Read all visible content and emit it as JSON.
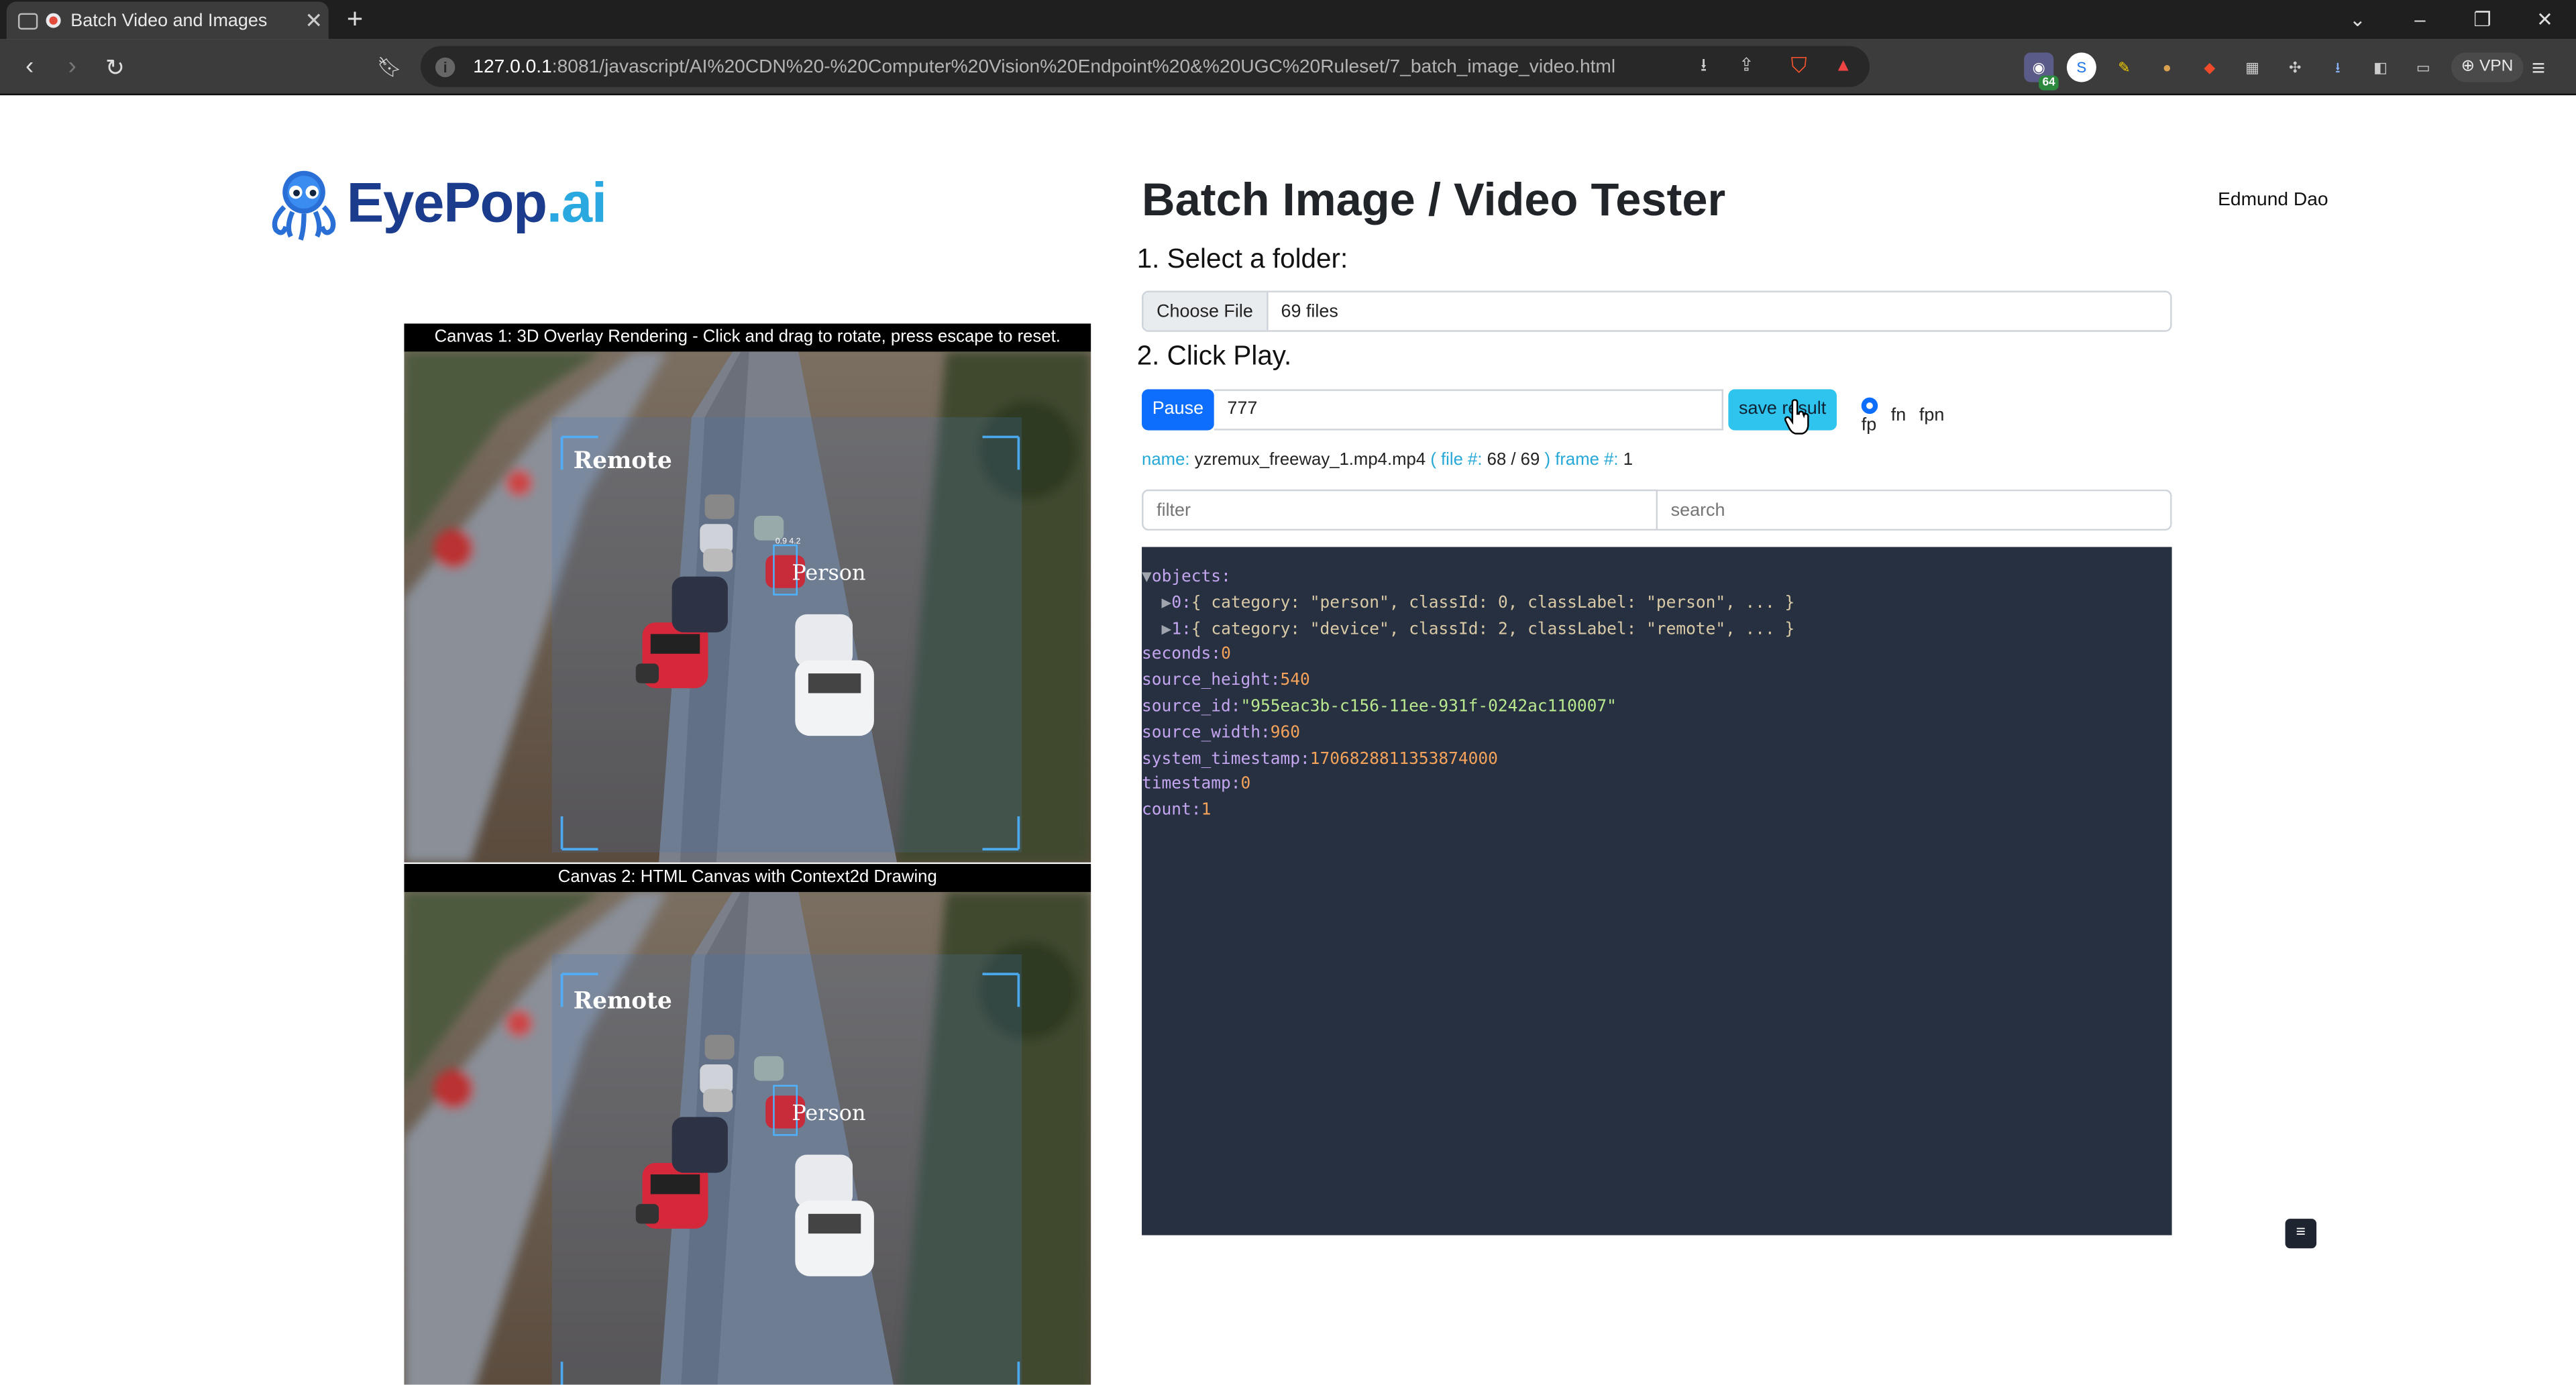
{
  "browser": {
    "tab_title": "Batch Video and Images",
    "url_host": "127.0.0.1",
    "url_rest": ":8081/javascript/AI%20CDN%20-%20Computer%20Vision%20Endpoint%20&%20UGC%20Ruleset/7_batch_image_video.html",
    "ext_badge": "64",
    "vpn_label": "VPN"
  },
  "logo": {
    "brand": "EyePop",
    "tld": ".ai"
  },
  "page": {
    "title": "Batch Image / Video Tester",
    "user_name": "Edmund Dao",
    "step1": "1. Select a folder:",
    "step2": "2. Click Play.",
    "choose_file_label": "Choose File",
    "file_count": "69 files",
    "pause_label": "Pause",
    "number_value": "777",
    "save_label": "save result",
    "radio_options": [
      "fp",
      "fn",
      "fpn"
    ],
    "radio_selected": "fp",
    "filter_placeholder": "filter",
    "search_placeholder": "search"
  },
  "status": {
    "name_label": "name:",
    "name_value": "yzremux_freeway_1.mp4.mp4",
    "file_label": "( file #:",
    "file_value": "68 / 69",
    "frame_label": ") frame #:",
    "frame_value": "1"
  },
  "canvas1": {
    "caption": "Canvas 1: 3D Overlay Rendering - Click and drag to rotate, press escape to reset.",
    "label_remote": "Remote",
    "label_person": "Person",
    "small_label": "0.9 4.2"
  },
  "canvas2": {
    "caption": "Canvas 2: HTML Canvas with Context2d Drawing",
    "label_remote": "Remote",
    "label_person": "Person"
  },
  "json_view": {
    "lines": [
      {
        "indent": 0,
        "prefix": "▼",
        "key": "objects",
        "sep": ":",
        "value": "",
        "type": "none"
      },
      {
        "indent": 2,
        "prefix": "▶",
        "key": "0",
        "sep": ":",
        "value": "{ category: \"person\", classId: 0, classLabel: \"person\", ... }",
        "type": "obj"
      },
      {
        "indent": 2,
        "prefix": "▶",
        "key": "1",
        "sep": ":",
        "value": "{ category: \"device\", classId: 2, classLabel: \"remote\", ... }",
        "type": "obj"
      },
      {
        "indent": 0,
        "prefix": "",
        "key": "seconds",
        "sep": ":",
        "value": "0",
        "type": "num"
      },
      {
        "indent": 0,
        "prefix": "",
        "key": "source_height",
        "sep": ":",
        "value": "540",
        "type": "num"
      },
      {
        "indent": 0,
        "prefix": "",
        "key": "source_id",
        "sep": ":",
        "value": "\"955eac3b-c156-11ee-931f-0242ac110007\"",
        "type": "str"
      },
      {
        "indent": 0,
        "prefix": "",
        "key": "source_width",
        "sep": ":",
        "value": "960",
        "type": "num"
      },
      {
        "indent": 0,
        "prefix": "",
        "key": "system_timestamp",
        "sep": ":",
        "value": "1706828811353874000",
        "type": "num"
      },
      {
        "indent": 0,
        "prefix": "",
        "key": "timestamp",
        "sep": ":",
        "value": "0",
        "type": "num"
      },
      {
        "indent": 0,
        "prefix": "",
        "key": "count",
        "sep": ":",
        "value": "1",
        "type": "num"
      }
    ],
    "toggle_label": "≡"
  },
  "colors": {
    "accent": "#0d6efd",
    "save": "#2ec4ee",
    "json_bg": "#263040",
    "brand": "#1b3b8c",
    "brand_light": "#29a9e0"
  }
}
